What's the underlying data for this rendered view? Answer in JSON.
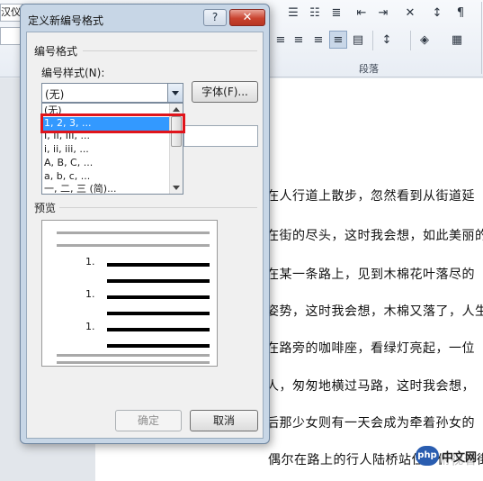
{
  "ribbon": {
    "font_name": "汉仪咖",
    "paragraph_group_label": "段落"
  },
  "document": {
    "lines": [
      "在人行道上散步，忽然看到从街道延",
      "在街的尽头，这时我会想，如此美丽的",
      "在某一条路上，见到木棉花叶落尽的",
      "姿势，这时我会想，木棉又落了，人生",
      "在路旁的咖啡座，看绿灯亮起，一位",
      "人，匆匆地横过马路，这时我会想，",
      "后那少女则有一天会成为牵着孙女的",
      "偶尔在路上的行人陆桥站住，俯视着街"
    ]
  },
  "watermark": {
    "logo": "php",
    "text": "中文网"
  },
  "dialog": {
    "title": "定义新编号格式",
    "help_label": "?",
    "close_label": "✕",
    "number_format_section": "编号格式",
    "number_style_label": "编号样式(N):",
    "number_style_value": "(无)",
    "font_button": "字体(F)...",
    "style_options": [
      "(无)",
      "1, 2, 3, ...",
      "I, II, III, ...",
      "i, ii, iii, ...",
      "A, B, C, ...",
      "a, b, c, ...",
      "一, 二, 三 (简)..."
    ],
    "selected_option_index": 1,
    "preview_section": "预览",
    "preview_numbers": [
      "1.",
      "1.",
      "1."
    ],
    "ok_button": "确定",
    "cancel_button": "取消"
  },
  "colors": {
    "selection": "#3399ff",
    "highlight": "#e0141b",
    "close_button": "#c9432f"
  }
}
